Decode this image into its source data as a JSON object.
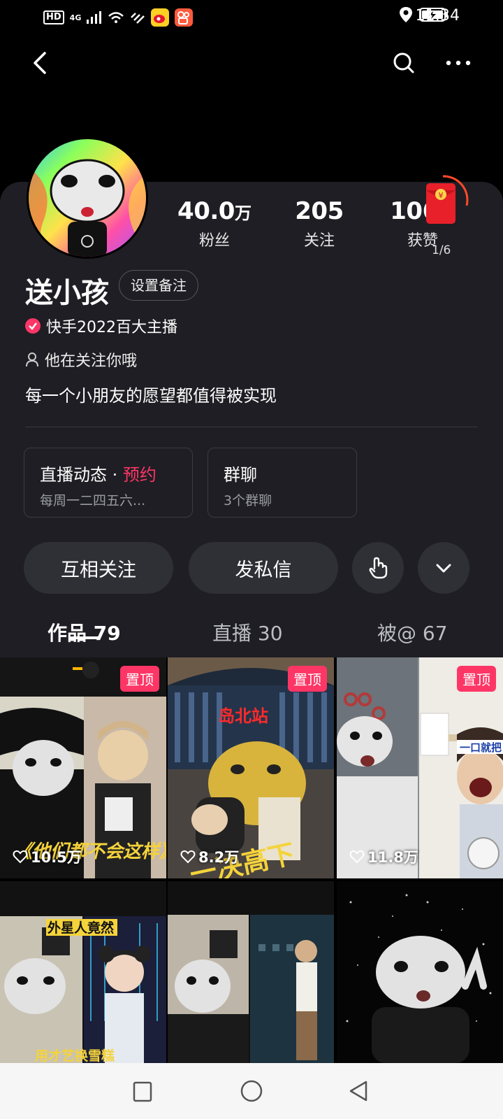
{
  "status_bar": {
    "hd": "HD",
    "network": "4G",
    "time": "11:34"
  },
  "profile": {
    "name": "送小孩",
    "remark_button": "设置备注",
    "verification": "快手2022百大主播",
    "follow_note": "他在关注你哦",
    "bio": "每一个小朋友的愿望都值得被实现"
  },
  "stats": {
    "fans": {
      "value": "40.0",
      "unit": "万",
      "label": "粉丝"
    },
    "following": {
      "value": "205",
      "unit": "",
      "label": "关注"
    },
    "likes": {
      "value": "106",
      "unit": "万",
      "label": "获赞"
    }
  },
  "red_packet": {
    "count": "1/6",
    "icon": "red-envelope-icon"
  },
  "cards": {
    "live": {
      "title": "直播动态 · ",
      "accent": "预约",
      "subtitle": "每周一二四五六..."
    },
    "group": {
      "title": "群聊",
      "subtitle": "3个群聊"
    }
  },
  "actions": {
    "mutual_follow": "互相关注",
    "message": "发私信"
  },
  "tabs": [
    {
      "label": "作品 79",
      "active": true
    },
    {
      "label": "直播 30",
      "active": false
    },
    {
      "label": "被@ 67",
      "active": false
    }
  ],
  "videos": [
    {
      "pinned": "置顶",
      "likes": "10.5万",
      "caption": "《他们都不会这样》"
    },
    {
      "pinned": "置顶",
      "likes": "8.2万",
      "caption": "一决高下",
      "sign": "岛北站"
    },
    {
      "pinned": "置顶",
      "likes": "11.8万",
      "caption": "一口就把"
    },
    {
      "caption_top": "外星人竟然",
      "caption_bottom": "用才艺换雪糕"
    },
    {},
    {}
  ],
  "colors": {
    "accent": "#fe3666",
    "panel": "#1e1e24",
    "button": "#2f2f36"
  }
}
